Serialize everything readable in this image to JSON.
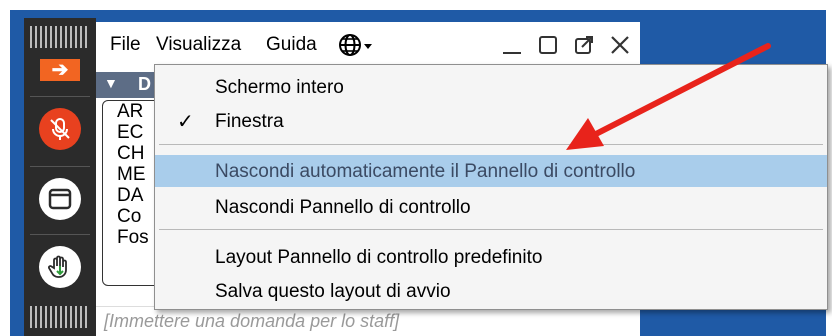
{
  "menubar": {
    "file": "File",
    "view": "Visualizza",
    "help": "Guida"
  },
  "section": {
    "label": "D"
  },
  "list_items": [
    "AR",
    "EC",
    "CH",
    "ME",
    "DA",
    "Co",
    "Fos"
  ],
  "question_placeholder": "[Immettere una domanda per lo staff]",
  "view_menu": {
    "fullscreen": "Schermo intero",
    "window": "Finestra",
    "auto_hide": "Nascondi automaticamente il Pannello di controllo",
    "hide_panel": "Nascondi Pannello di controllo",
    "default_layout": "Layout Pannello di controllo predefinito",
    "save_layout": "Salva questo layout di avvio"
  },
  "colors": {
    "frame_blue": "#1f5aa6",
    "toolbar_dark": "#2b2b2b",
    "accent_orange": "#f26522",
    "mic_red": "#e8411f",
    "highlight": "#a9cdeb",
    "annotation_arrow": "#e8231b"
  },
  "icons": {
    "collapse_toolbar": "arrow-right-icon",
    "microphone": "mic-muted-icon",
    "window": "window-icon",
    "raise_hand": "hand-icon",
    "language": "globe-icon"
  }
}
